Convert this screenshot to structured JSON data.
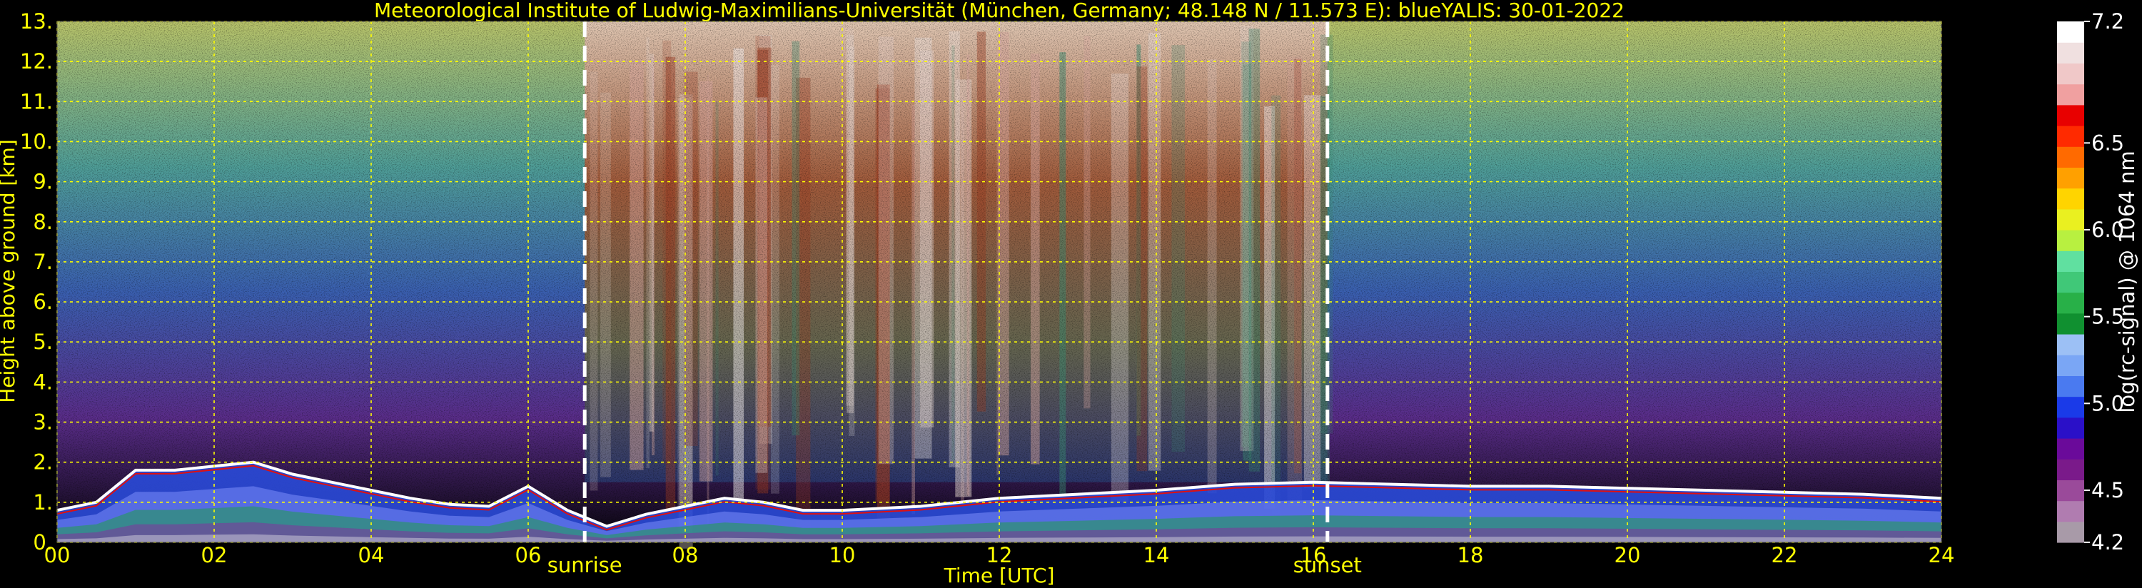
{
  "chart_data": {
    "type": "heatmap",
    "title": "Meteorological Institute of Ludwig-Maximilians-Universität (München, Germany; 48.148 N / 11.573 E):     blueYALIS: 30-01-2022",
    "xlabel": "Time [UTC]",
    "ylabel": "Height above ground [km]",
    "xlim": [
      0,
      24
    ],
    "ylim": [
      0,
      13
    ],
    "x_ticks": [
      "00",
      "02",
      "04",
      "06",
      "08",
      "10",
      "12",
      "14",
      "16",
      "18",
      "20",
      "22",
      "24"
    ],
    "y_ticks": [
      "0.",
      "1.",
      "2.",
      "3.",
      "4.",
      "5.",
      "6.",
      "7.",
      "8.",
      "9.",
      "10.",
      "11.",
      "12.",
      "13."
    ],
    "grid": true,
    "annotations": [
      {
        "label": "sunrise",
        "x": 6.72
      },
      {
        "label": "sunset",
        "x": 16.18
      }
    ],
    "colorbar": {
      "label": "log(rc-signal) @ 1064 nm",
      "range": [
        4.2,
        7.2
      ],
      "ticks": [
        "4.2",
        "4.5",
        "5.0",
        "5.5",
        "6.0",
        "6.5",
        "7.2"
      ],
      "tick_values": [
        4.2,
        4.5,
        5.0,
        5.5,
        6.0,
        6.5,
        7.2
      ],
      "colors": [
        "#a89aa8",
        "#b07cb0",
        "#9a4a9a",
        "#7a1a8a",
        "#6a0a9a",
        "#2a10c8",
        "#1a3ae8",
        "#4a7af0",
        "#7aa6f5",
        "#9cc0f5",
        "#109030",
        "#28b048",
        "#40c878",
        "#60e0a0",
        "#b8f040",
        "#eaf020",
        "#ffd400",
        "#ffa000",
        "#ff6a00",
        "#ff2a00",
        "#e80000",
        "#f0a0a0",
        "#f0c8c8",
        "#f0e0e0",
        "#ffffff"
      ]
    },
    "boundary_layer_top": {
      "x": [
        0,
        0.5,
        1,
        1.5,
        2,
        2.5,
        3,
        3.5,
        4,
        4.5,
        5,
        5.5,
        6,
        6.5,
        7,
        7.5,
        8,
        8.5,
        9,
        9.5,
        10,
        11,
        12,
        13,
        14,
        15,
        16,
        17,
        18,
        19,
        20,
        21,
        22,
        23,
        24
      ],
      "y": [
        0.8,
        1.0,
        1.8,
        1.8,
        1.9,
        2.0,
        1.7,
        1.5,
        1.3,
        1.1,
        0.95,
        0.9,
        1.4,
        0.8,
        0.4,
        0.7,
        0.9,
        1.1,
        1.0,
        0.8,
        0.8,
        0.9,
        1.1,
        1.2,
        1.3,
        1.45,
        1.5,
        1.45,
        1.4,
        1.4,
        1.35,
        1.3,
        1.25,
        1.2,
        1.1
      ]
    }
  }
}
